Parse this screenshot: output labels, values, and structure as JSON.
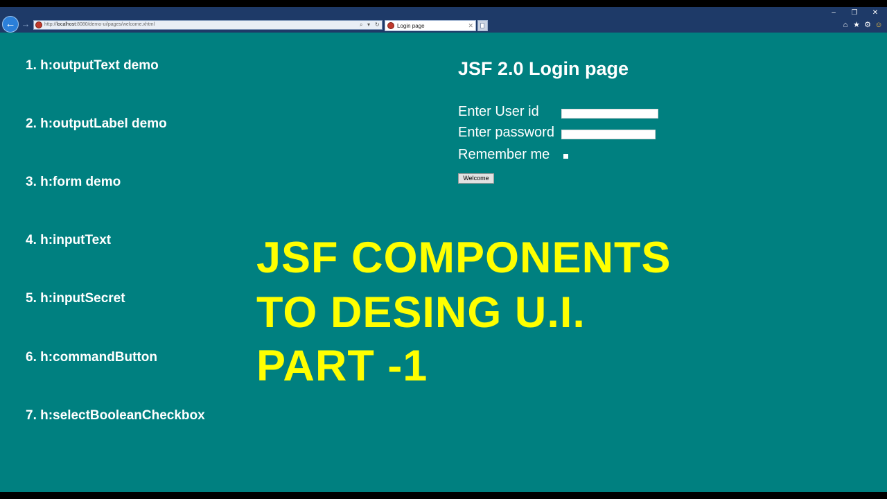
{
  "browser": {
    "back_glyph": "←",
    "forward_glyph": "→",
    "address": {
      "scheme": "http://",
      "host": "localhost",
      "path": ":8080/demo-ui/pages/welcome.xhtml",
      "search_glyph": "⌕",
      "dropdown_glyph": "▾",
      "refresh_glyph": "↻"
    },
    "tab": {
      "title": "Login page",
      "close_glyph": "✕"
    },
    "window_controls": {
      "minimize": "–",
      "restore": "❐",
      "close": "✕"
    },
    "toolbar_icons": {
      "home": "⌂",
      "favorites": "★",
      "settings": "⚙",
      "feedback": "☺"
    }
  },
  "page": {
    "background_color": "#008080",
    "sidebar_items": [
      "1. h:outputText demo",
      "2. h:outputLabel demo",
      "3. h:form demo",
      "4. h:inputText",
      "5. h:inputSecret",
      "6. h:commandButton",
      "7. h:selectBooleanCheckbox"
    ],
    "login": {
      "title": "JSF 2.0 Login page",
      "user_label": "Enter User id",
      "user_value": "",
      "password_label": "Enter password",
      "password_value": "",
      "remember_label": "Remember me",
      "remember_checked": false,
      "button_label": "Welcome"
    },
    "headline": {
      "color": "#ffff00",
      "lines": [
        "JSF COMPONENTS",
        "TO DESING U.I.",
        "PART -1"
      ]
    }
  }
}
